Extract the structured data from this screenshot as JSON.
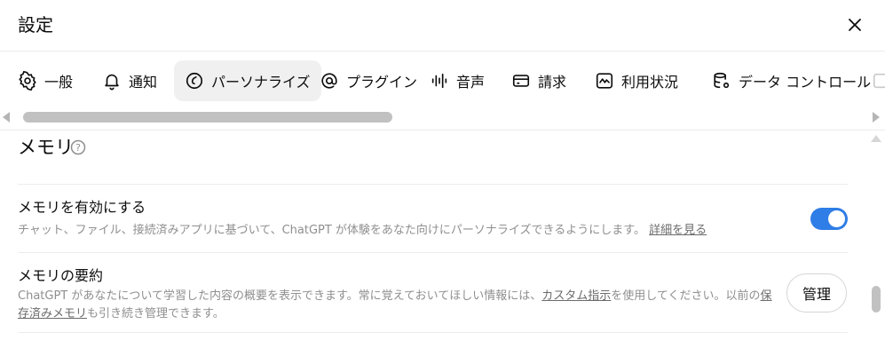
{
  "header": {
    "title": "設定"
  },
  "tabs": [
    {
      "label": "一般",
      "icon": "gear-icon"
    },
    {
      "label": "通知",
      "icon": "bell-icon"
    },
    {
      "label": "パーソナライズ",
      "icon": "personalize-icon",
      "active": true
    },
    {
      "label": "プラグイン",
      "icon": "at-sign-icon"
    },
    {
      "label": "音声",
      "icon": "waveform-icon"
    },
    {
      "label": "請求",
      "icon": "credit-card-icon"
    },
    {
      "label": "利用状況",
      "icon": "chart-icon"
    },
    {
      "label": "データ コントロール",
      "icon": "database-gear-icon"
    }
  ],
  "memory": {
    "title": "メモリ",
    "enable": {
      "title": "メモリを有効にする",
      "desc": "チャット、ファイル、接続済みアプリに基づいて、ChatGPT が体験をあなた向けにパーソナライズできるようにします。",
      "link": "詳細を見る",
      "enabled": true
    },
    "summary": {
      "title": "メモリの要約",
      "desc_part1": "ChatGPT があなたについて学習した内容の概要を表示できます。常に覚えておいてほしい情報には、",
      "link1": "カスタム指示",
      "desc_part2": "を使用してください。以前の",
      "link2": "保存済みメモリ",
      "desc_part3": "も引き続き管理できます。",
      "button": "管理"
    }
  },
  "colors": {
    "accent": "#2f7de6"
  }
}
